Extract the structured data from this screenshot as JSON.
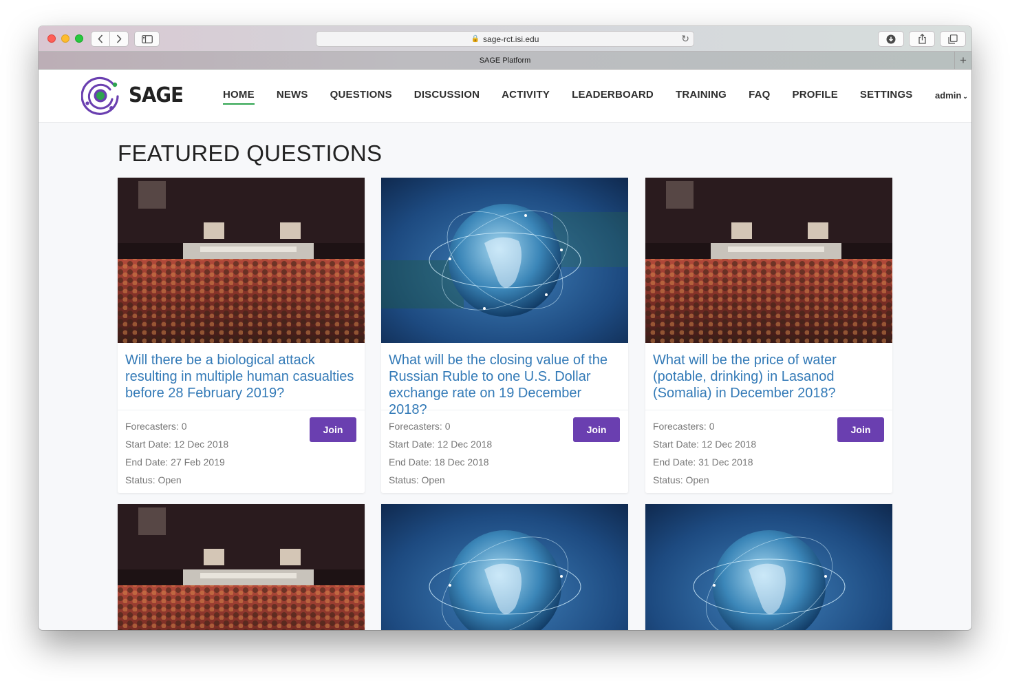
{
  "browser": {
    "url": "sage-rct.isi.edu",
    "tab_title": "SAGE Platform",
    "new_tab_label": "+"
  },
  "site": {
    "brand": "SAGE",
    "nav": [
      "HOME",
      "NEWS",
      "QUESTIONS",
      "DISCUSSION",
      "ACTIVITY",
      "LEADERBOARD",
      "TRAINING",
      "FAQ",
      "PROFILE",
      "SETTINGS"
    ],
    "active_nav": "HOME",
    "user": "admin"
  },
  "page_title": "FEATURED QUESTIONS",
  "colors": {
    "link": "#337ab7",
    "join_button": "#6a3fb0",
    "nav_active_underline": "#2ea44f",
    "logo_purple": "#6a3fb0",
    "logo_green": "#2ea44f"
  },
  "cards": [
    {
      "image": "concert-crowd",
      "title": "Will there be a biological attack resulting in multiple human casualties before 28 February 2019?",
      "forecasters": "Forecasters: 0",
      "start": "Start Date: 12 Dec 2018",
      "end": "End Date: 27 Feb 2019",
      "status": "Status: Open",
      "button": "Join"
    },
    {
      "image": "globe-network",
      "title": "What will be the closing value of the Russian Ruble to one U.S. Dollar exchange rate on 19 December 2018?",
      "forecasters": "Forecasters: 0",
      "start": "Start Date: 12 Dec 2018",
      "end": "End Date: 18 Dec 2018",
      "status": "Status: Open",
      "button": "Join"
    },
    {
      "image": "concert-crowd",
      "title": "What will be the price of water (potable, drinking) in Lasanod (Somalia) in December 2018?",
      "forecasters": "Forecasters: 0",
      "start": "Start Date: 12 Dec 2018",
      "end": "End Date: 31 Dec 2018",
      "status": "Status: Open",
      "button": "Join"
    },
    {
      "image": "concert-crowd"
    },
    {
      "image": "globe-network"
    },
    {
      "image": "globe-network"
    }
  ]
}
